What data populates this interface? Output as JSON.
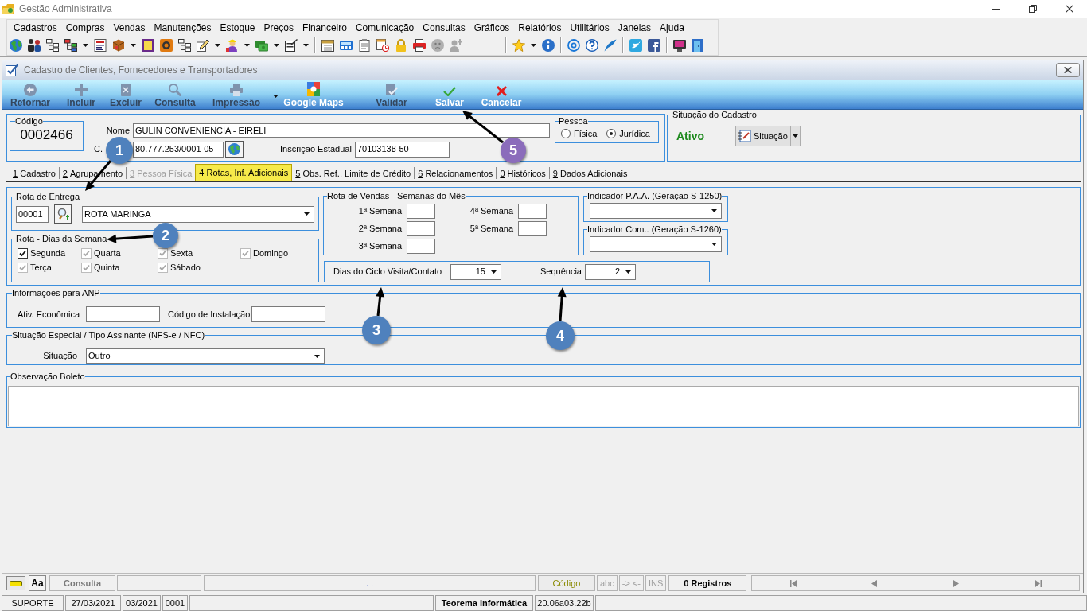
{
  "window": {
    "title": "Gestão Administrativa"
  },
  "menu": [
    "Cadastros",
    "Compras",
    "Vendas",
    "Manutenções",
    "Estoque",
    "Preços",
    "Financeiro",
    "Comunicação",
    "Consultas",
    "Gráficos",
    "Relatórios",
    "Utilitários",
    "Janelas",
    "Ajuda"
  ],
  "form": {
    "title": "Cadastro de Clientes, Fornecedores e Transportadores"
  },
  "toolbar": [
    {
      "label": "Retornar",
      "disabled": true,
      "dropdown": false
    },
    {
      "label": "Incluir",
      "disabled": true,
      "dropdown": false
    },
    {
      "label": "Excluir",
      "disabled": true,
      "dropdown": false
    },
    {
      "label": "Consulta",
      "disabled": true,
      "dropdown": false
    },
    {
      "label": "Impressão",
      "disabled": true,
      "dropdown": true
    },
    {
      "label": "Google Maps",
      "disabled": false,
      "dropdown": false
    },
    {
      "label": "Validar",
      "disabled": true,
      "dropdown": false
    },
    {
      "label": "Salvar",
      "disabled": false,
      "dropdown": false
    },
    {
      "label": "Cancelar",
      "disabled": false,
      "dropdown": false
    }
  ],
  "header": {
    "code_label": "Código",
    "code": "0002466",
    "name_label": "Nome",
    "name": "GULIN CONVENIENCIA - EIRELI",
    "cnpj_label": "C.",
    "cnpj": "80.777.253/0001-05",
    "ie_label": "Inscrição Estadual",
    "ie": "70103138-50",
    "pessoa": {
      "title": "Pessoa",
      "options": [
        {
          "label": "Física",
          "selected": false
        },
        {
          "label": "Jurídica",
          "selected": true
        }
      ]
    }
  },
  "situacao_cadastro": {
    "title": "Situação do Cadastro",
    "value": "Ativo",
    "button": "Situação"
  },
  "tabs": [
    {
      "key": "1",
      "label": "Cadastro",
      "selected": false,
      "disabled": false
    },
    {
      "key": "2",
      "label": "Agrupamento",
      "selected": false,
      "disabled": false
    },
    {
      "key": "3",
      "label": "Pessoa Física",
      "selected": false,
      "disabled": true
    },
    {
      "key": "4",
      "label": "Rotas, Inf. Adicionais",
      "selected": true,
      "disabled": false
    },
    {
      "key": "5",
      "label": "Obs. Ref., Limite de Crédito",
      "selected": false,
      "disabled": false
    },
    {
      "key": "6",
      "label": "Relacionamentos",
      "selected": false,
      "disabled": false
    },
    {
      "key": "0",
      "label": "Históricos",
      "selected": false,
      "disabled": false
    },
    {
      "key": "9",
      "label": "Dados Adicionais",
      "selected": false,
      "disabled": false
    }
  ],
  "rota_entrega": {
    "title": "Rota de Entrega",
    "code": "00001",
    "route": "ROTA MARINGA"
  },
  "dias_semana": {
    "title": "Rota - Dias da Semana",
    "days": [
      {
        "label": "Segunda",
        "checked": true,
        "grayed": false
      },
      {
        "label": "Quarta",
        "checked": true,
        "grayed": true
      },
      {
        "label": "Sexta",
        "checked": true,
        "grayed": true
      },
      {
        "label": "Domingo",
        "checked": true,
        "grayed": true
      },
      {
        "label": "Terça",
        "checked": true,
        "grayed": true
      },
      {
        "label": "Quinta",
        "checked": true,
        "grayed": true
      },
      {
        "label": "Sábado",
        "checked": true,
        "grayed": true
      }
    ]
  },
  "rota_vendas": {
    "title": "Rota de Vendas - Semanas do Mês",
    "weeks": [
      "1ª Semana",
      "4ª Semana",
      "2ª Semana",
      "5ª Semana",
      "3ª Semana"
    ]
  },
  "indicadores": [
    {
      "title": "Indicador P.A.A. (Geração S-1250)"
    },
    {
      "title": "Indicador Com.. (Geração S-1260)"
    }
  ],
  "ciclo": {
    "label": "Dias do Ciclo Visita/Contato",
    "value": "15",
    "sequence_label": "Sequência",
    "sequence": "2"
  },
  "anp": {
    "title": "Informações para ANP",
    "fields": [
      "Ativ. Econômica",
      "Código de Instalação"
    ]
  },
  "situacao_especial": {
    "title": "Situação Especial / Tipo Assinante (NFS-e / NFC)",
    "label": "Situação",
    "value": "Outro"
  },
  "observacao": {
    "title": "Observação Boleto"
  },
  "bottom_bar": {
    "font_button": "Aa",
    "mode": "Consulta",
    "info": ". .",
    "field": "Código",
    "indicators": [
      {
        "label": "abc",
        "active": false
      },
      {
        "label": "-> <-",
        "active": false
      },
      {
        "label": "INS",
        "active": false
      }
    ],
    "records": "0 Registros"
  },
  "status_bar": [
    {
      "text": "SUPORTE",
      "bold": false
    },
    {
      "text": "27/03/2021",
      "bold": false
    },
    {
      "text": "03/2021",
      "bold": false
    },
    {
      "text": "0001",
      "bold": false
    },
    {
      "text": "Teorema Informática",
      "bold": true
    },
    {
      "text": "20.06a03.22b",
      "bold": false
    }
  ],
  "annotations": [
    {
      "label": "1",
      "color": "#4f81bd"
    },
    {
      "label": "2",
      "color": "#4f81bd"
    },
    {
      "label": "3",
      "color": "#4f81bd"
    },
    {
      "label": "4",
      "color": "#4f81bd"
    },
    {
      "label": "5",
      "color": "#8b6cbb"
    }
  ]
}
